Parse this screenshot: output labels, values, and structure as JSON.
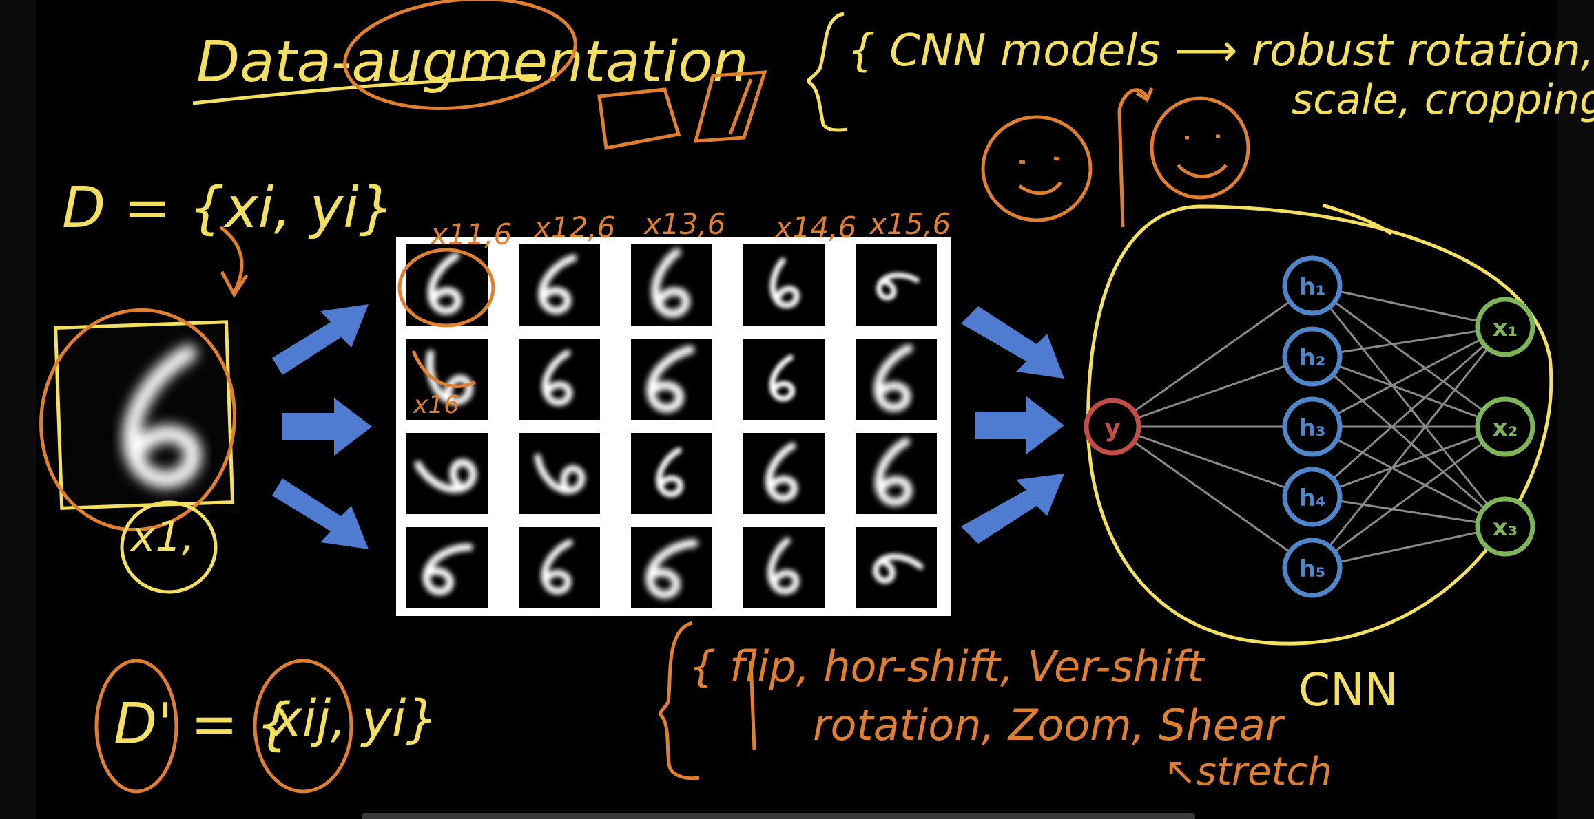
{
  "colors": {
    "background": "#000000",
    "ink_yellow": "#f3e060",
    "ink_orange": "#e07f2f",
    "arrow_blue": "#4f7bd0",
    "hidden_node": "#4f86c9",
    "output_node": "#7fb559",
    "input_node": "#c24c46",
    "edge": "#8a8a8a"
  },
  "notes": {
    "title": "Data-augmentation",
    "dataset": "D = {xi, yi}",
    "sample_label": "x1,",
    "aug_dataset_prefix": "D' = {",
    "aug_dataset_x": "xij,",
    "aug_dataset_y": "yi}",
    "cnn_models": "{ CNN models ⟶ robust rotation,",
    "cnn_models_cont": "scale, cropping",
    "augment_list_1": "{ flip, hor-shift, Ver-shift",
    "augment_list_2": "rotation, Zoom, Shear",
    "stretch": "↖stretch",
    "cnn_label": "CNN",
    "col_labels": [
      "x11,6",
      "x12,6",
      "x13,6",
      "x14,6",
      "x15,6"
    ],
    "row2_label": "x16"
  },
  "network": {
    "input": "y",
    "hidden": [
      "h₁",
      "h₂",
      "h₃",
      "h₄",
      "h₅"
    ],
    "outputs": [
      "x₁",
      "x₂",
      "x₃"
    ]
  },
  "augmented_grid": {
    "rows": 4,
    "cols": 5
  }
}
